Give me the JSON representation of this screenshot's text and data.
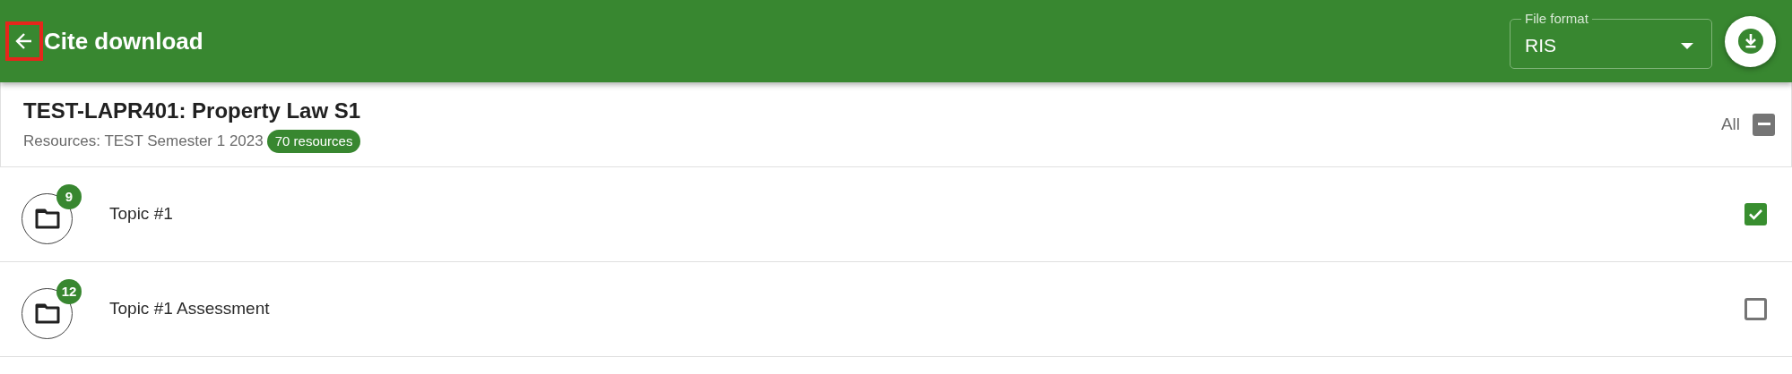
{
  "header": {
    "back_button": {
      "highlighted": true
    },
    "title": "Cite download",
    "file_format": {
      "label": "File format",
      "value": "RIS"
    }
  },
  "course": {
    "title": "TEST-LAPR401: Property Law S1",
    "subtitle": "Resources: TEST Semester 1 2023",
    "count_badge": "70 resources",
    "select_all": {
      "label": "All",
      "indeterminate": true
    }
  },
  "topics": [
    {
      "name": "Topic #1",
      "count": "9",
      "checked": true
    },
    {
      "name": "Topic #1 Assessment",
      "count": "12",
      "checked": false
    }
  ]
}
